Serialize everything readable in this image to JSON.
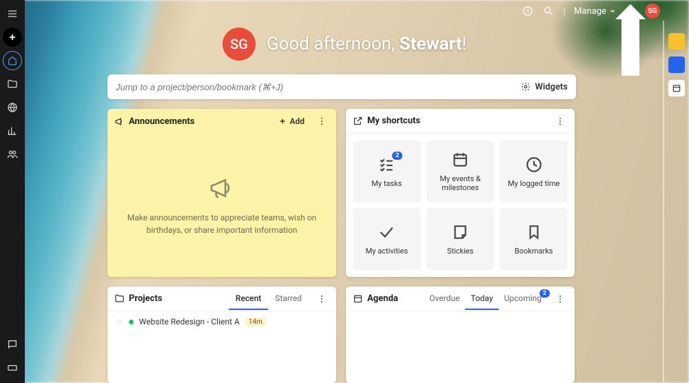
{
  "user": {
    "initials": "SG",
    "name": "Stewart"
  },
  "greeting": {
    "prefix": "Good afternoon, ",
    "suffix": "!"
  },
  "topbar": {
    "manage": "Manage"
  },
  "search": {
    "placeholder": "Jump to a project/person/bookmark (⌘+J)",
    "widgets_label": "Widgets"
  },
  "announcements": {
    "title": "Announcements",
    "add_label": "Add",
    "empty_text": "Make announcements to appreciate teams, wish on birthdays, or share important information"
  },
  "shortcuts": {
    "title": "My shortcuts",
    "items": [
      {
        "label": "My tasks",
        "icon": "checklist",
        "badge": "2"
      },
      {
        "label": "My events & milestones",
        "icon": "calendar"
      },
      {
        "label": "My logged time",
        "icon": "clock"
      },
      {
        "label": "My activities",
        "icon": "check"
      },
      {
        "label": "Stickies",
        "icon": "note"
      },
      {
        "label": "Bookmarks",
        "icon": "bookmark"
      }
    ]
  },
  "projects": {
    "title": "Projects",
    "tabs": {
      "recent": "Recent",
      "starred": "Starred"
    },
    "items": [
      {
        "name": "Website Redesign - Client A",
        "time": "14m"
      }
    ]
  },
  "agenda": {
    "title": "Agenda",
    "tabs": {
      "overdue": "Overdue",
      "today": "Today",
      "upcoming": "Upcoming"
    },
    "upcoming_badge": "2"
  }
}
